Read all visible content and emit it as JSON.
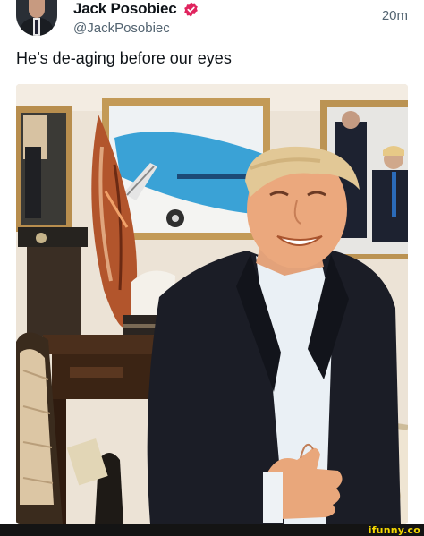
{
  "post": {
    "author_name": "Jack Posobiec",
    "handle": "@JackPosobiec",
    "timestamp": "20m",
    "text": "He’s de-aging before our eyes",
    "verified_color": "#e0245e"
  },
  "watermark": {
    "text": "ifunny.co",
    "color": "#f5d800"
  }
}
